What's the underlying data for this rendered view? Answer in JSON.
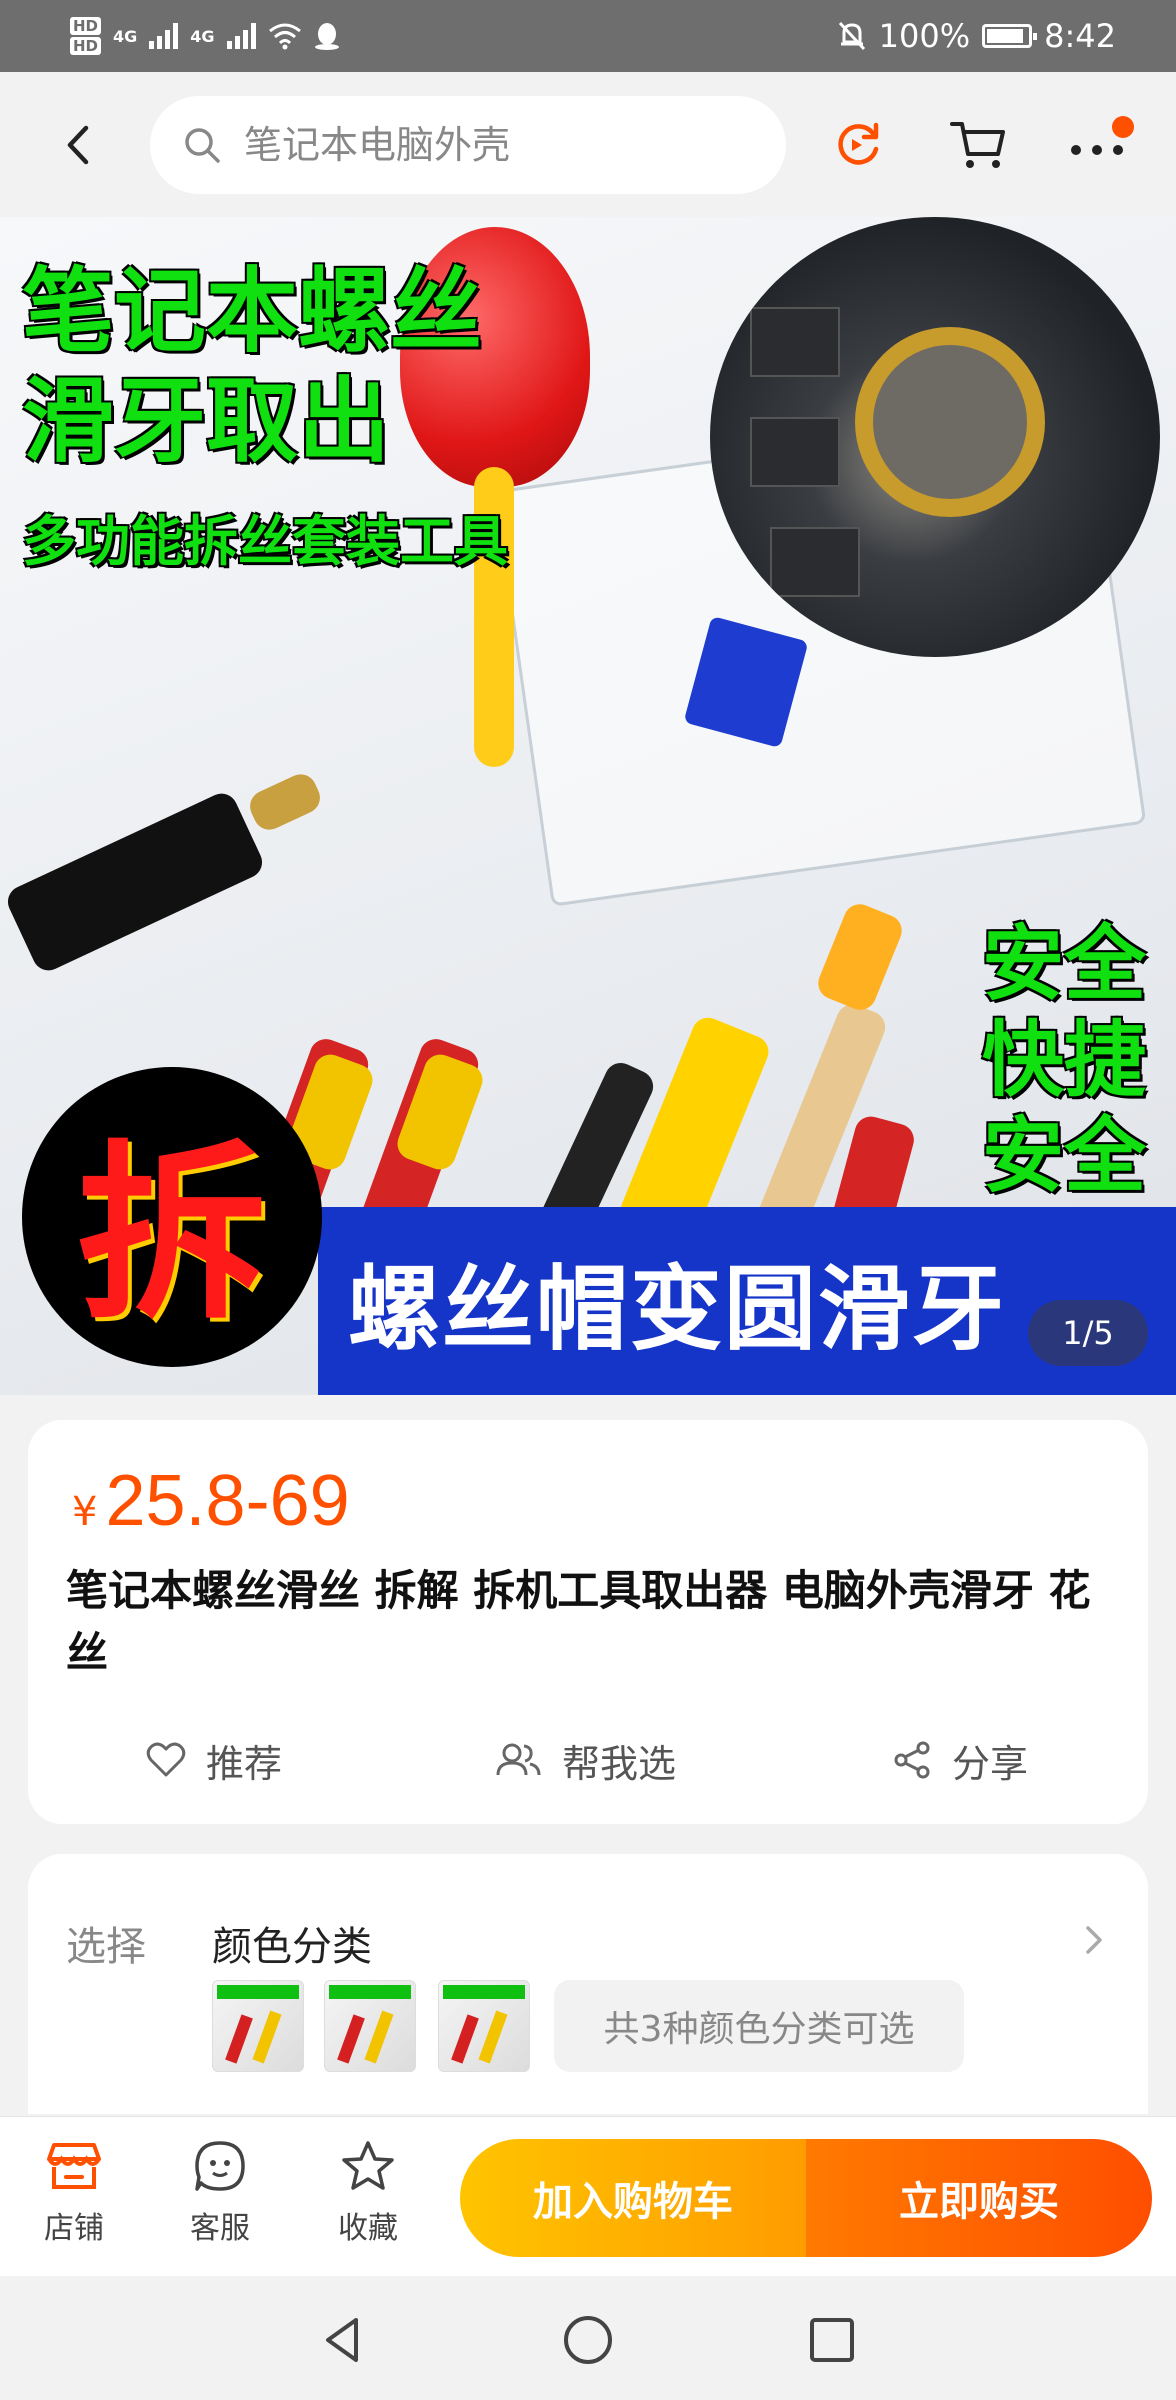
{
  "status_bar": {
    "hd1": "HD",
    "hd2": "HD",
    "signal1": "4G",
    "signal2": "4G",
    "battery": "100%",
    "time": "8:42"
  },
  "search": {
    "placeholder": "笔记本电脑外壳"
  },
  "product_image": {
    "headline1": "笔记本螺丝",
    "headline2": "滑牙取出",
    "subhead": "多功能拆丝套装工具",
    "side1": "安全",
    "side2": "快捷",
    "side3": "安全",
    "big_char": "拆",
    "banner": "螺丝帽变圆滑牙",
    "page_indicator": "1/5"
  },
  "product": {
    "currency": "¥",
    "price": "25.8-69",
    "title": "笔记本螺丝滑丝 拆解 拆机工具取出器 电脑外壳滑牙 花丝"
  },
  "actions": {
    "recommend": "推荐",
    "help_choose": "帮我选",
    "share": "分享"
  },
  "selection": {
    "label": "选择",
    "value": "颜色分类",
    "more": "共3种颜色分类可选"
  },
  "bottom_bar": {
    "shop": "店铺",
    "service": "客服",
    "favorite": "收藏",
    "add_to_cart": "加入购物车",
    "buy_now": "立即购买"
  },
  "colors": {
    "accent": "#ff5000",
    "cart_button": "#ffb000",
    "buy_button": "#ff5a00"
  }
}
